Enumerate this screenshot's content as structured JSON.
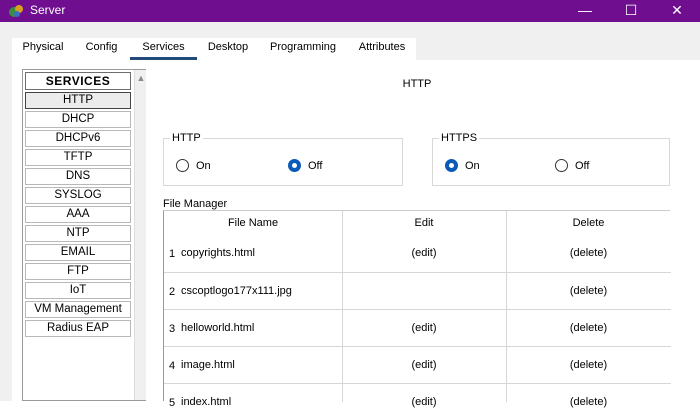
{
  "window": {
    "title": "Server",
    "minimize": "—",
    "maximize": "☐",
    "close": "✕"
  },
  "tabs": [
    {
      "label": "Physical"
    },
    {
      "label": "Config"
    },
    {
      "label": "Services"
    },
    {
      "label": "Desktop"
    },
    {
      "label": "Programming"
    },
    {
      "label": "Attributes"
    }
  ],
  "services": {
    "header": "SERVICES",
    "items": [
      "HTTP",
      "DHCP",
      "DHCPv6",
      "TFTP",
      "DNS",
      "SYSLOG",
      "AAA",
      "NTP",
      "EMAIL",
      "FTP",
      "IoT",
      "VM Management",
      "Radius EAP"
    ],
    "selected": "HTTP"
  },
  "panel": {
    "title": "HTTP",
    "http": {
      "legend": "HTTP",
      "on": "On",
      "off": "Off",
      "state": "off"
    },
    "https": {
      "legend": "HTTPS",
      "on": "On",
      "off": "Off",
      "state": "on"
    }
  },
  "file_manager": {
    "label": "File Manager",
    "columns": [
      "File Name",
      "Edit",
      "Delete"
    ],
    "rows": [
      {
        "num": "1",
        "name": "copyrights.html",
        "edit": "(edit)",
        "delete": "(delete)"
      },
      {
        "num": "2",
        "name": "cscoptlogo177x111.jpg",
        "edit": "",
        "delete": "(delete)"
      },
      {
        "num": "3",
        "name": "helloworld.html",
        "edit": "(edit)",
        "delete": "(delete)"
      },
      {
        "num": "4",
        "name": "image.html",
        "edit": "(edit)",
        "delete": "(delete)"
      },
      {
        "num": "5",
        "name": "index.html",
        "edit": "(edit)",
        "delete": "(delete)"
      }
    ]
  }
}
